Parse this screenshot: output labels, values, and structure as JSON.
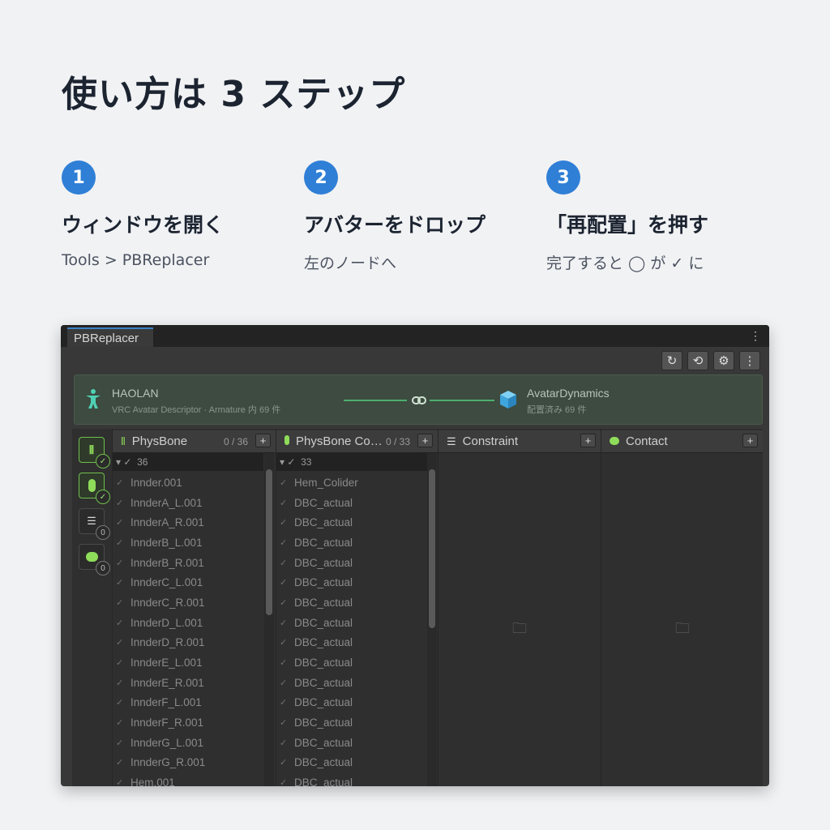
{
  "title": "使い方は 3 ステップ",
  "steps": [
    {
      "num": "1",
      "heading": "ウィンドウを開く",
      "sub": "Tools > PBReplacer"
    },
    {
      "num": "2",
      "heading": "アバターをドロップ",
      "sub": "左のノードへ"
    },
    {
      "num": "3",
      "heading": "「再配置」を押す",
      "sub": "完了すると ◯ が ✓ に"
    }
  ],
  "window": {
    "tab": "PBReplacer",
    "toolbar": {
      "refresh": "↻",
      "history": "⟲",
      "settings": "⚙",
      "menu": "⋮"
    },
    "source": {
      "name": "HAOLAN",
      "detail": "VRC Avatar Descriptor · Armature 内 69 件"
    },
    "target": {
      "name": "AvatarDynamics",
      "detail": "配置済み 69 件"
    },
    "sidebar_badges": [
      "✓",
      "✓",
      "0",
      "0"
    ],
    "columns": [
      {
        "name": "PhysBone",
        "count": "0 / 36",
        "group_count": "36",
        "items": [
          "Innder.001",
          "InnderA_L.001",
          "InnderA_R.001",
          "InnderB_L.001",
          "InnderB_R.001",
          "InnderC_L.001",
          "InnderC_R.001",
          "InnderD_L.001",
          "InnderD_R.001",
          "InnderE_L.001",
          "InnderE_R.001",
          "InnderF_L.001",
          "InnderF_R.001",
          "InnderG_L.001",
          "InnderG_R.001",
          "Hem.001"
        ]
      },
      {
        "name": "PhysBone Co…",
        "count": "0 / 33",
        "group_count": "33",
        "items": [
          "Hem_Colider",
          "DBC_actual",
          "DBC_actual",
          "DBC_actual",
          "DBC_actual",
          "DBC_actual",
          "DBC_actual",
          "DBC_actual",
          "DBC_actual",
          "DBC_actual",
          "DBC_actual",
          "DBC_actual",
          "DBC_actual",
          "DBC_actual",
          "DBC_actual",
          "DBC_actual"
        ]
      },
      {
        "name": "Constraint"
      },
      {
        "name": "Contact"
      }
    ],
    "colors": {
      "accent": "#2f7fd6",
      "green": "#6fbf4c",
      "link": "#4caf6e"
    }
  }
}
